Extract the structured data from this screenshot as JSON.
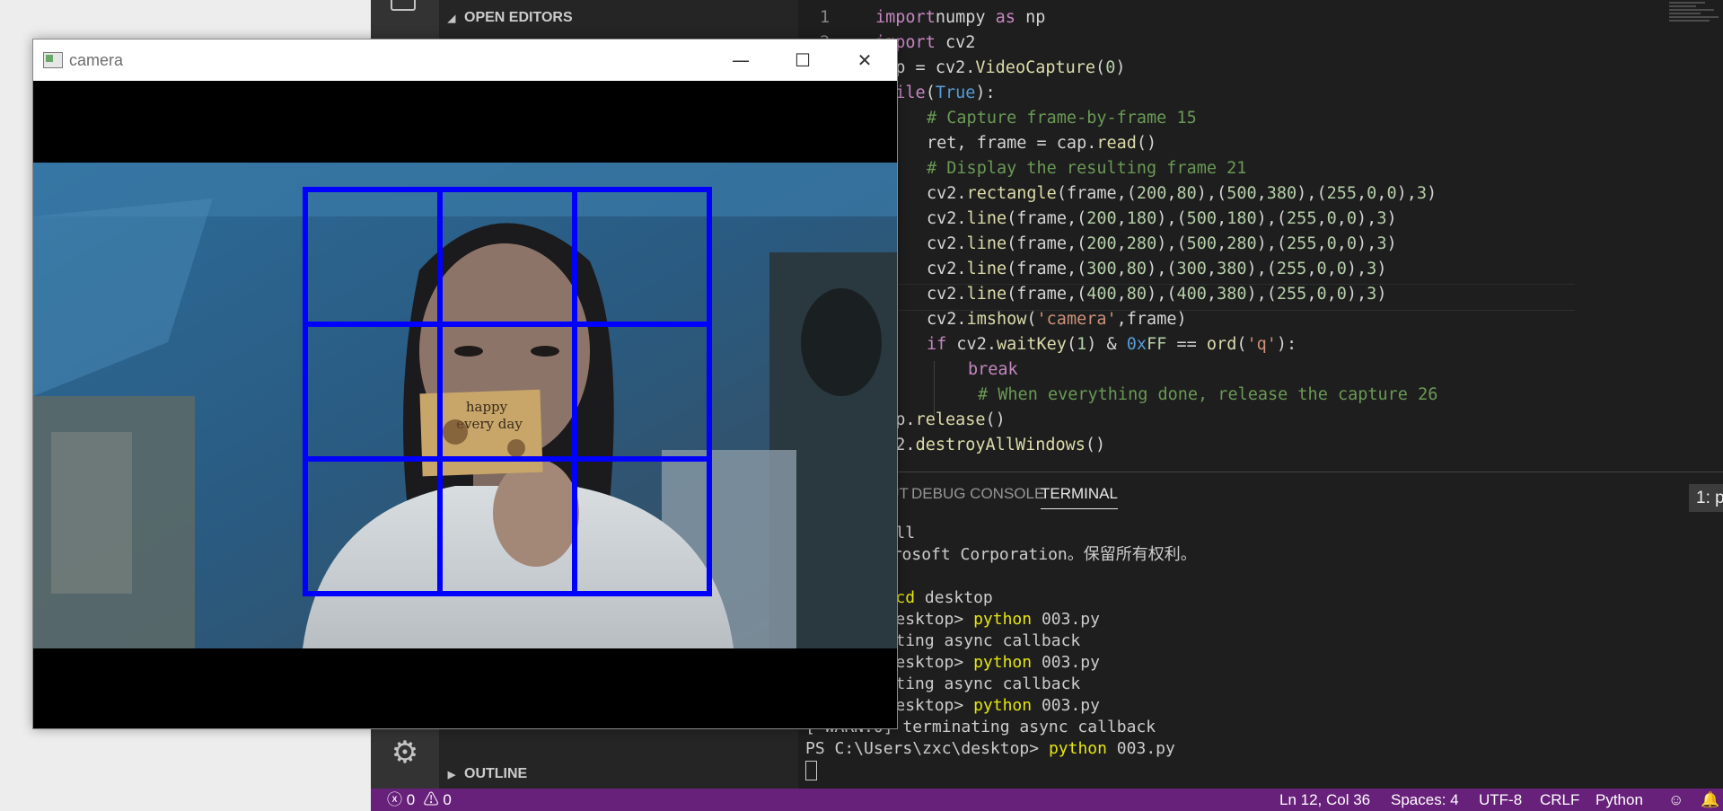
{
  "vscode": {
    "sidebar": {
      "open_editors_label": "OPEN EDITORS",
      "outline_label": "OUTLINE"
    },
    "editor": {
      "line_numbers": [
        "1",
        "2"
      ],
      "lines": [
        [
          [
            "kw",
            "import"
          ],
          [
            "",
            "numpy "
          ],
          [
            "kw",
            "as"
          ],
          [
            "",
            " np"
          ]
        ],
        [
          [
            "kw",
            "import"
          ],
          [
            "",
            ""
          ],
          [
            "",
            " cv2"
          ]
        ],
        [
          [
            "",
            "cap = cv2."
          ],
          [
            "fn",
            "VideoCapture"
          ],
          [
            "",
            "("
          ],
          [
            "nm",
            "0"
          ],
          [
            "",
            ")"
          ]
        ],
        [
          [
            "kw",
            "while"
          ],
          [
            "",
            "("
          ],
          [
            "kb",
            "True"
          ],
          [
            "",
            "):"
          ]
        ],
        [
          [
            "cm",
            "# Capture frame-by-frame 15"
          ]
        ],
        [
          [
            "",
            "ret, frame = cap."
          ],
          [
            "fn",
            "read"
          ],
          [
            "",
            "()"
          ]
        ],
        [
          [
            "cm",
            "# Display the resulting frame 21"
          ]
        ],
        [
          [
            "",
            "cv2."
          ],
          [
            "fn",
            "rectangle"
          ],
          [
            "",
            "(frame,("
          ],
          [
            "nm",
            "200"
          ],
          [
            "",
            ","
          ],
          [
            "nm",
            "80"
          ],
          [
            "",
            "),("
          ],
          [
            "nm",
            "500"
          ],
          [
            "",
            ","
          ],
          [
            "nm",
            "380"
          ],
          [
            "",
            "),("
          ],
          [
            "nm",
            "255"
          ],
          [
            "",
            ","
          ],
          [
            "nm",
            "0"
          ],
          [
            "",
            ","
          ],
          [
            "nm",
            "0"
          ],
          [
            "",
            "),"
          ],
          [
            "nm",
            "3"
          ],
          [
            "",
            ")"
          ]
        ],
        [
          [
            "",
            "cv2."
          ],
          [
            "fn",
            "line"
          ],
          [
            "",
            "(frame,("
          ],
          [
            "nm",
            "200"
          ],
          [
            "",
            ","
          ],
          [
            "nm",
            "180"
          ],
          [
            "",
            "),("
          ],
          [
            "nm",
            "500"
          ],
          [
            "",
            ","
          ],
          [
            "nm",
            "180"
          ],
          [
            "",
            "),("
          ],
          [
            "nm",
            "255"
          ],
          [
            "",
            ","
          ],
          [
            "nm",
            "0"
          ],
          [
            "",
            ","
          ],
          [
            "nm",
            "0"
          ],
          [
            "",
            "),"
          ],
          [
            "nm",
            "3"
          ],
          [
            "",
            ")"
          ]
        ],
        [
          [
            "",
            "cv2."
          ],
          [
            "fn",
            "line"
          ],
          [
            "",
            "(frame,("
          ],
          [
            "nm",
            "200"
          ],
          [
            "",
            ","
          ],
          [
            "nm",
            "280"
          ],
          [
            "",
            "),("
          ],
          [
            "nm",
            "500"
          ],
          [
            "",
            ","
          ],
          [
            "nm",
            "280"
          ],
          [
            "",
            "),("
          ],
          [
            "nm",
            "255"
          ],
          [
            "",
            ","
          ],
          [
            "nm",
            "0"
          ],
          [
            "",
            ","
          ],
          [
            "nm",
            "0"
          ],
          [
            "",
            "),"
          ],
          [
            "nm",
            "3"
          ],
          [
            "",
            ")"
          ]
        ],
        [
          [
            "",
            "cv2."
          ],
          [
            "fn",
            "line"
          ],
          [
            "",
            "(frame,("
          ],
          [
            "nm",
            "300"
          ],
          [
            "",
            ","
          ],
          [
            "nm",
            "80"
          ],
          [
            "",
            "),("
          ],
          [
            "nm",
            "300"
          ],
          [
            "",
            ","
          ],
          [
            "nm",
            "380"
          ],
          [
            "",
            "),("
          ],
          [
            "nm",
            "255"
          ],
          [
            "",
            ","
          ],
          [
            "nm",
            "0"
          ],
          [
            "",
            ","
          ],
          [
            "nm",
            "0"
          ],
          [
            "",
            "),"
          ],
          [
            "nm",
            "3"
          ],
          [
            "",
            ")"
          ]
        ],
        [
          [
            "",
            "cv2."
          ],
          [
            "fn",
            "line"
          ],
          [
            "",
            "(frame,("
          ],
          [
            "nm",
            "400"
          ],
          [
            "",
            ","
          ],
          [
            "nm",
            "80"
          ],
          [
            "",
            "),("
          ],
          [
            "nm",
            "400"
          ],
          [
            "",
            ","
          ],
          [
            "nm",
            "380"
          ],
          [
            "",
            "),("
          ],
          [
            "nm",
            "255"
          ],
          [
            "",
            ","
          ],
          [
            "nm",
            "0"
          ],
          [
            "",
            ","
          ],
          [
            "nm",
            "0"
          ],
          [
            "",
            "),"
          ],
          [
            "nm",
            "3"
          ],
          [
            "",
            ")"
          ]
        ],
        [
          [
            "",
            "cv2."
          ],
          [
            "fn",
            "imshow"
          ],
          [
            "",
            "("
          ],
          [
            "st",
            "'camera'"
          ],
          [
            "",
            ",frame)"
          ]
        ],
        [
          [
            "kw",
            "if"
          ],
          [
            "",
            " cv2."
          ],
          [
            "fn",
            "waitKey"
          ],
          [
            "",
            "("
          ],
          [
            "nm",
            "1"
          ],
          [
            "",
            ") & "
          ],
          [
            "kb",
            "0x"
          ],
          [
            "nm",
            "FF"
          ],
          [
            "",
            " == "
          ],
          [
            "fn",
            "ord"
          ],
          [
            "",
            "("
          ],
          [
            "st",
            "'q'"
          ],
          [
            "",
            "):"
          ]
        ],
        [
          [
            "kw",
            "break"
          ]
        ],
        [
          [
            "cm",
            "# When everything done, release the capture 26"
          ]
        ],
        [
          [
            "",
            "cap."
          ],
          [
            "fn",
            "release"
          ],
          [
            "",
            "()"
          ]
        ],
        [
          [
            "",
            "cv2."
          ],
          [
            "fn",
            "destroyAllWindows"
          ],
          [
            "",
            "()"
          ]
        ]
      ]
    },
    "panel": {
      "tabs": [
        "S",
        "OUTPUT",
        "DEBUG CONSOLE",
        "TERMINAL"
      ],
      "terminal_select": "1: python",
      "terminal_lines": [
        [
          [
            "",
            "  PowerShell"
          ]
        ],
        [
          [
            "",
            "有 (C) Microsoft Corporation。保留所有权利。"
          ]
        ],
        [
          [
            "",
            ""
          ]
        ],
        [
          [
            "",
            "sers\\zxc> "
          ],
          [
            "yl",
            "cd"
          ],
          [
            "",
            " desktop"
          ]
        ],
        [
          [
            "",
            "sers\\zxc\\desktop> "
          ],
          [
            "yl",
            "python"
          ],
          [
            "",
            " 003.py"
          ]
        ],
        [
          [
            "",
            "0] terminating async callback"
          ]
        ],
        [
          [
            "",
            "sers\\zxc\\desktop> "
          ],
          [
            "yl",
            "python"
          ],
          [
            "",
            " 003.py"
          ]
        ],
        [
          [
            "",
            "0] terminating async callback"
          ]
        ],
        [
          [
            "",
            "sers\\zxc\\desktop> "
          ],
          [
            "yl",
            "python"
          ],
          [
            "",
            " 003.py"
          ]
        ],
        [
          [
            "",
            "[ WARN:0] terminating async callback"
          ]
        ],
        [
          [
            "",
            "PS C:\\Users\\zxc\\desktop> "
          ],
          [
            "yl",
            "python"
          ],
          [
            "",
            " 003.py"
          ]
        ]
      ]
    },
    "statusbar": {
      "errors": "0",
      "warnings": "0",
      "position": "Ln 12, Col 36",
      "spaces": "Spaces: 4",
      "encoding": "UTF-8",
      "eol": "CRLF",
      "language": "Python"
    }
  },
  "camera_window": {
    "title": "camera",
    "overlay_color": "#0000ff",
    "card_text": [
      "happy",
      "every day"
    ]
  }
}
